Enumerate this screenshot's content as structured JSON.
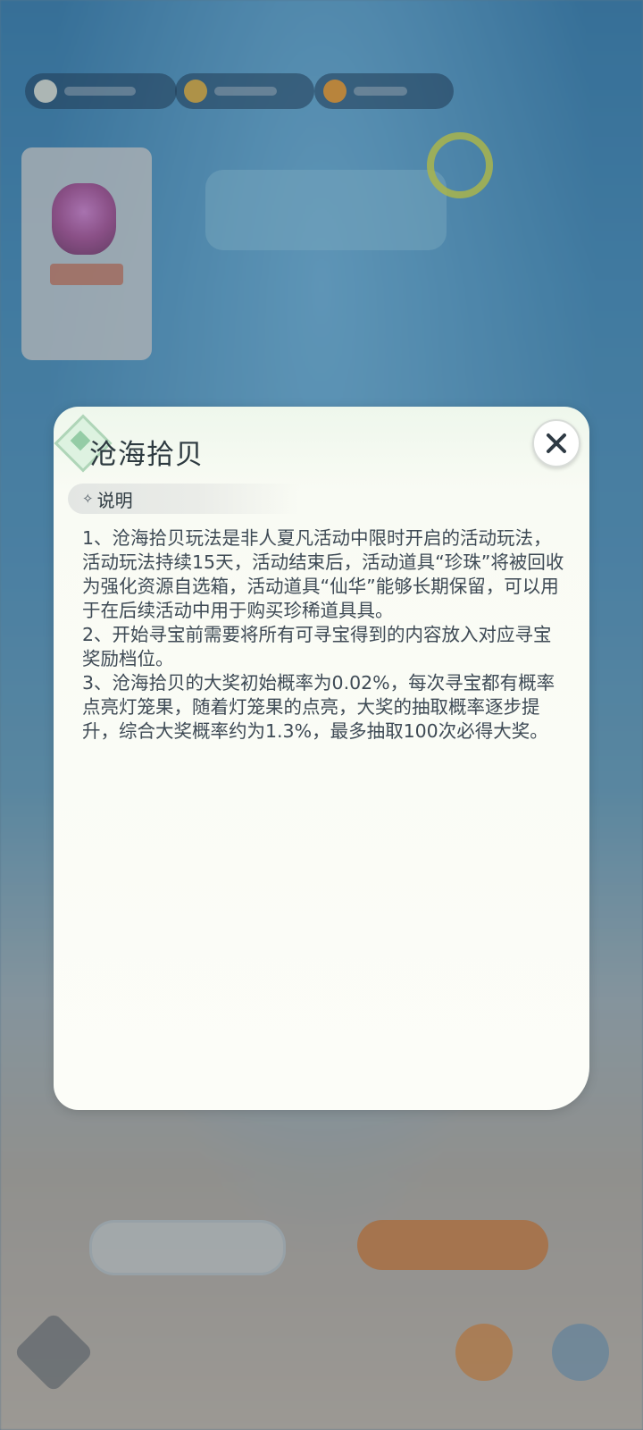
{
  "modal": {
    "title": "沧海拾贝",
    "section_label": "说明",
    "paragraphs": [
      "1、沧海拾贝玩法是非人夏凡活动中限时开启的活动玩法，活动玩法持续15天，活动结束后，活动道具“珍珠”将被回收为强化资源自选箱，活动道具“仙华”能够长期保留，可以用于在后续活动中用于购买珍稀道具具。",
      "2、开始寻宝前需要将所有可寻宝得到的内容放入对应寻宝奖励档位。",
      "3、沧海拾贝的大奖初始概率为0.02%，每次寻宝都有概率点亮灯笼果，随着灯笼果的点亮，大奖的抽取概率逐步提升，综合大奖概率约为1.3%，最多抽取100次必得大奖。"
    ]
  },
  "icons": {
    "close": "close-icon",
    "sparkle": "sparkle-icon"
  },
  "colors": {
    "modal_bg": "#fcfdf8",
    "title": "#2d3a40",
    "text": "#3e4a55"
  }
}
